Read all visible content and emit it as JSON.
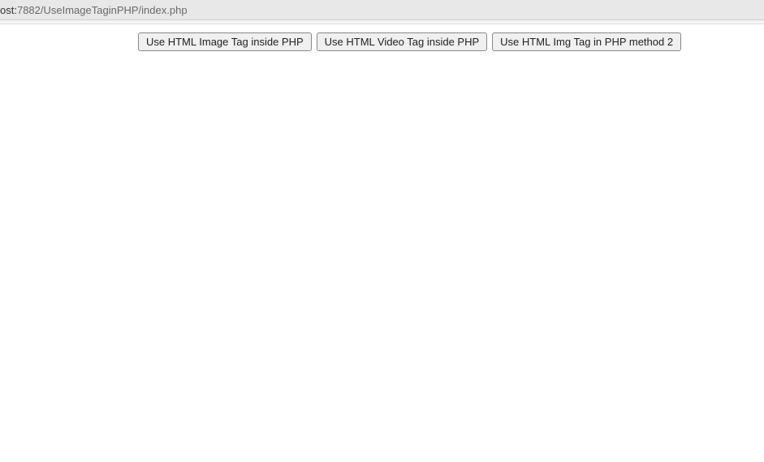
{
  "address_bar": {
    "prefix": "ost:",
    "path": "7882/UseImageTaginPHP/index.php"
  },
  "buttons": {
    "btn1": "Use HTML Image Tag inside PHP",
    "btn2": "Use HTML Video Tag inside PHP",
    "btn3": "Use HTML Img Tag in PHP method 2"
  }
}
